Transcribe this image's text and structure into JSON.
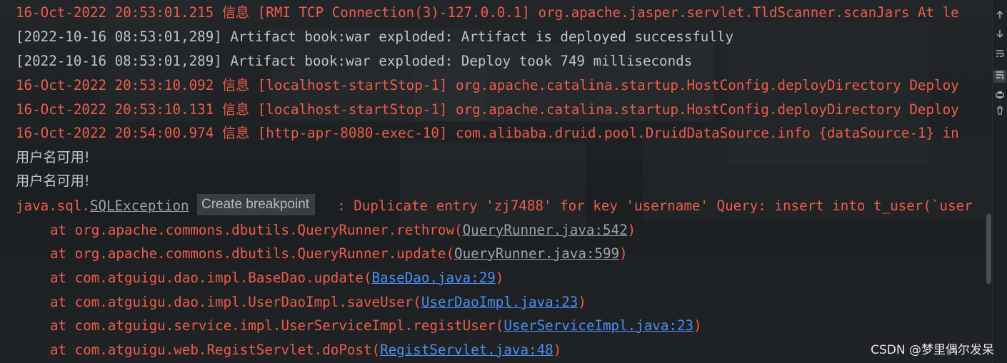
{
  "console": {
    "lines": [
      {
        "time": "16-Oct-2022 20:53:01.215",
        "level": "信息",
        "thread": "[RMI TCP Connection(3)-127.0.0.1]",
        "message": "org.apache.jasper.servlet.TldScanner.scanJars At le"
      },
      {
        "plain": "[2022-10-16 08:53:01,289] Artifact book:war exploded: Artifact is deployed successfully"
      },
      {
        "plain": "[2022-10-16 08:53:01,289] Artifact book:war exploded: Deploy took 749 milliseconds"
      },
      {
        "time": "16-Oct-2022 20:53:10.092",
        "level": "信息",
        "thread": "[localhost-startStop-1]",
        "message": "org.apache.catalina.startup.HostConfig.deployDirectory Deploy"
      },
      {
        "time": "16-Oct-2022 20:53:10.131",
        "level": "信息",
        "thread": "[localhost-startStop-1]",
        "message": "org.apache.catalina.startup.HostConfig.deployDirectory Deploy"
      },
      {
        "time": "16-Oct-2022 20:54:00.974",
        "level": "信息",
        "thread": "[http-apr-8080-exec-10]",
        "message": "com.alibaba.druid.pool.DruidDataSource.info {dataSource-1} in"
      },
      {
        "plain": "用户名可用!"
      },
      {
        "plain": "用户名可用!"
      }
    ],
    "exception": {
      "prefix": "java.sql.",
      "class": "SQLException",
      "message": " : Duplicate entry 'zj7488' for key 'username' Query: insert into t_user(`user"
    },
    "tooltip": "Create breakpoint",
    "stack": [
      {
        "at": "at org.apache.commons.dbutils.QueryRunner.rethrow(",
        "link": "QueryRunner.java:542",
        "style": "gray"
      },
      {
        "at": "at org.apache.commons.dbutils.QueryRunner.update(",
        "link": "QueryRunner.java:599",
        "style": "gray"
      },
      {
        "at": "at com.atguigu.dao.impl.BaseDao.update(",
        "link": "BaseDao.java:29",
        "style": "blue"
      },
      {
        "at": "at com.atguigu.dao.impl.UserDaoImpl.saveUser(",
        "link": "UserDaoImpl.java:23",
        "style": "blue"
      },
      {
        "at": "at com.atguigu.service.impl.UserServiceImpl.registUser(",
        "link": "UserServiceImpl.java:23",
        "style": "blue"
      },
      {
        "at": "at com.atguigu.web.RegistServlet.doPost(",
        "link": "RegistServlet.java:48",
        "style": "blue"
      }
    ],
    "close_paren": ")"
  },
  "gutter": {
    "icons": [
      "arrow-up-icon",
      "arrow-down-icon",
      "soft-wrap-icon",
      "scroll-to-end-icon",
      "print-icon",
      "clear-icon"
    ]
  },
  "watermark": "CSDN @梦里偶尔发呆",
  "colors": {
    "error": "#ef5b4a",
    "normal": "#c0c3c8",
    "link": "#4d8ef0",
    "link_muted": "#9ea3a8"
  }
}
